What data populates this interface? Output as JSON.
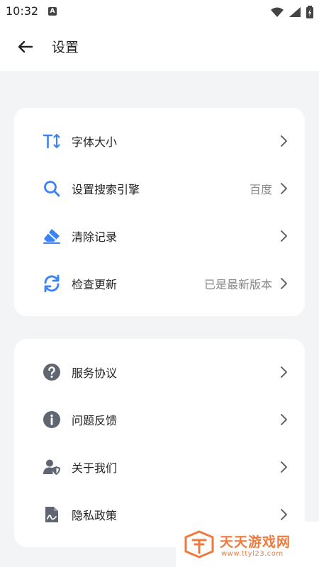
{
  "status": {
    "time": "10:32",
    "notif_icon": "a-icon"
  },
  "header": {
    "title": "设置",
    "back_icon": "arrow-left-icon"
  },
  "settings_group": [
    {
      "label": "字体大小",
      "value": "",
      "icon": "font-size-icon",
      "icon_color": "#3b82f6"
    },
    {
      "label": "设置搜索引擎",
      "value": "百度",
      "icon": "search-icon",
      "icon_color": "#3b82f6"
    },
    {
      "label": "清除记录",
      "value": "",
      "icon": "eraser-icon",
      "icon_color": "#3b82f6"
    },
    {
      "label": "检查更新",
      "value": "已是最新版本",
      "icon": "refresh-icon",
      "icon_color": "#3b82f6"
    }
  ],
  "info_group": [
    {
      "label": "服务协议",
      "icon": "question-icon",
      "icon_color": "#5f6672"
    },
    {
      "label": "问题反馈",
      "icon": "info-icon",
      "icon_color": "#5f6672"
    },
    {
      "label": "关于我们",
      "icon": "user-shield-icon",
      "icon_color": "#5f6672"
    },
    {
      "label": "隐私政策",
      "icon": "document-icon",
      "icon_color": "#5f6672"
    }
  ],
  "watermark": {
    "name": "天天游戏网",
    "url": "www.ttyl23.com"
  }
}
